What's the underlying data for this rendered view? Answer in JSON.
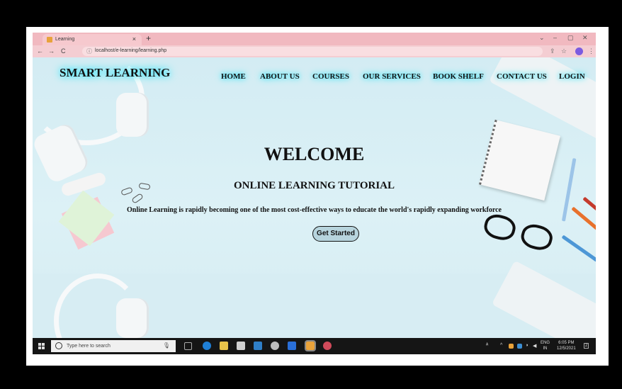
{
  "browser": {
    "tab_title": "Learning",
    "tab_close": "×",
    "new_tab": "+",
    "url": "localhost/e-learning/learning.php",
    "back": "←",
    "forward": "→",
    "reload": "C",
    "info_icon": "ⓘ",
    "share_icon": "⇪",
    "star_icon": "☆",
    "menu_icon": "⋮",
    "win_chevron": "⌄",
    "win_min": "–",
    "win_max": "▢",
    "win_close": "✕"
  },
  "site": {
    "logo": "SMART LEARNING",
    "nav": [
      "HOME",
      "ABOUT US",
      "COURSES",
      "OUR SERVICES",
      "BOOK SHELF",
      "CONTACT US",
      "LOGIN"
    ],
    "welcome": "WELCOME",
    "subtitle": "ONLINE LEARNING TUTORIAL",
    "description": "Online Learning is rapidly becoming one of the most cost-effective ways to educate the world's rapidly expanding workforce",
    "cta": "Get Started"
  },
  "taskbar": {
    "search_placeholder": "Type here to search",
    "mic_icon": "🎙",
    "lang_top": "ENG",
    "lang_bottom": "IN",
    "time": "6:05 PM",
    "date": "12/5/2021",
    "notif_count": "2"
  },
  "colors": {
    "glow": "#33e6ff",
    "tab_bg": "#f1b9c0",
    "taskbar": "#151515"
  }
}
